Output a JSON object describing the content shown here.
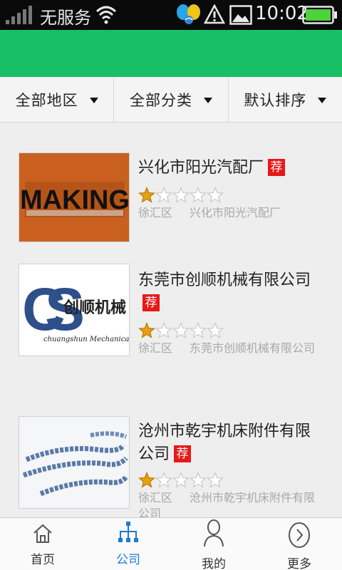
{
  "status_bar": {
    "carrier": "无服务",
    "time": "10:02",
    "icons": [
      "signal-icon",
      "wifi-icon",
      "bird-notification-icon",
      "warning-icon",
      "image-icon",
      "battery-icon"
    ]
  },
  "filters": [
    {
      "label": "全部地区"
    },
    {
      "label": "全部分类"
    },
    {
      "label": "默认排序"
    }
  ],
  "companies": [
    {
      "name": "兴化市阳光汽配厂",
      "rec_badge": "荐",
      "rating": 1,
      "max_rating": 5,
      "district": "徐汇区",
      "address": "兴化市阳光汽配厂",
      "logo_text": "MAKING"
    },
    {
      "name": "东莞市创顺机械有限公司",
      "rec_badge": "荐",
      "rating": 1,
      "max_rating": 5,
      "district": "徐汇区",
      "address": "东莞市创顺机械有限公司",
      "logo_text": "创顺机械",
      "logo_sub": "chuangshun Mechanical"
    },
    {
      "name": "沧州市乾宇机床附件有限公司",
      "rec_badge": "荐",
      "rating": 1,
      "max_rating": 5,
      "district": "徐汇区",
      "address": "沧州市乾宇机床附件有限公司"
    }
  ],
  "bottom_nav": [
    {
      "label": "首页",
      "icon": "home-icon",
      "active": false
    },
    {
      "label": "公司",
      "icon": "org-chart-icon",
      "active": true
    },
    {
      "label": "我的",
      "icon": "user-icon",
      "active": false
    },
    {
      "label": "更多",
      "icon": "more-icon",
      "active": false
    }
  ],
  "colors": {
    "header_green": "#18bf65",
    "active_blue": "#1a7ad4",
    "badge_red": "#e81818",
    "star_gold": "#e7a00f"
  }
}
